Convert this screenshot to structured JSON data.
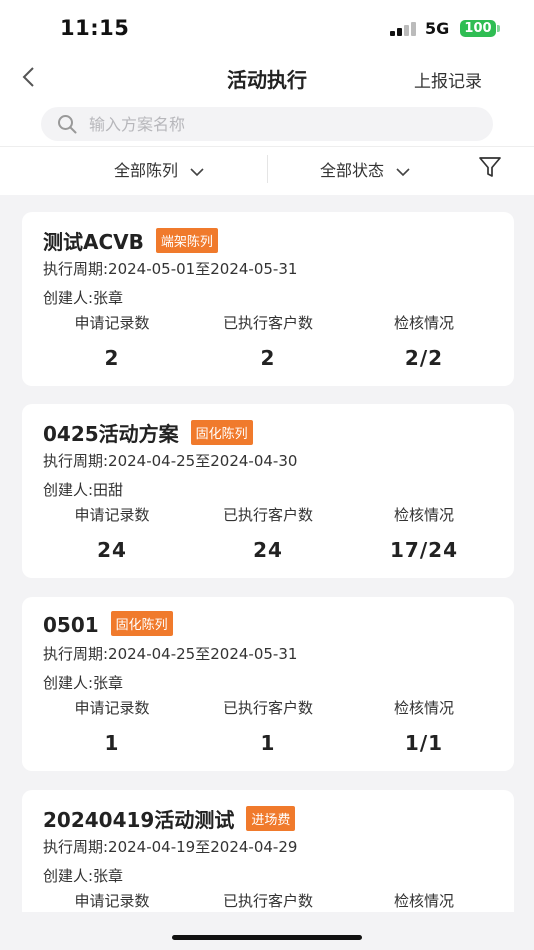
{
  "status_bar": {
    "time": "11:15",
    "network": "5G",
    "battery": "100"
  },
  "nav": {
    "title": "活动执行",
    "right_link": "上报记录"
  },
  "search": {
    "placeholder": "输入方案名称"
  },
  "filters": {
    "display": "全部陈列",
    "status": "全部状态"
  },
  "stat_labels": {
    "records": "申请记录数",
    "customers": "已执行客户数",
    "check": "检核情况"
  },
  "cards": [
    {
      "title": "测试ACVB",
      "tag": "端架陈列",
      "period": "执行周期:2024-05-01至2024-05-31",
      "creator": "创建人:张章",
      "records": "2",
      "customers": "2",
      "check": "2/2"
    },
    {
      "title": "0425活动方案",
      "tag": "固化陈列",
      "period": "执行周期:2024-04-25至2024-04-30",
      "creator": "创建人:田甜",
      "records": "24",
      "customers": "24",
      "check": "17/24"
    },
    {
      "title": "0501",
      "tag": "固化陈列",
      "period": "执行周期:2024-04-25至2024-05-31",
      "creator": "创建人:张章",
      "records": "1",
      "customers": "1",
      "check": "1/1"
    },
    {
      "title": "20240419活动测试",
      "tag": "进场费",
      "period": "执行周期:2024-04-19至2024-04-29",
      "creator": "创建人:张章",
      "records": "",
      "customers": "",
      "check": ""
    }
  ],
  "colors": {
    "tag": "#f07a2c",
    "battery": "#2fbd53",
    "background": "#f3f3f5"
  }
}
